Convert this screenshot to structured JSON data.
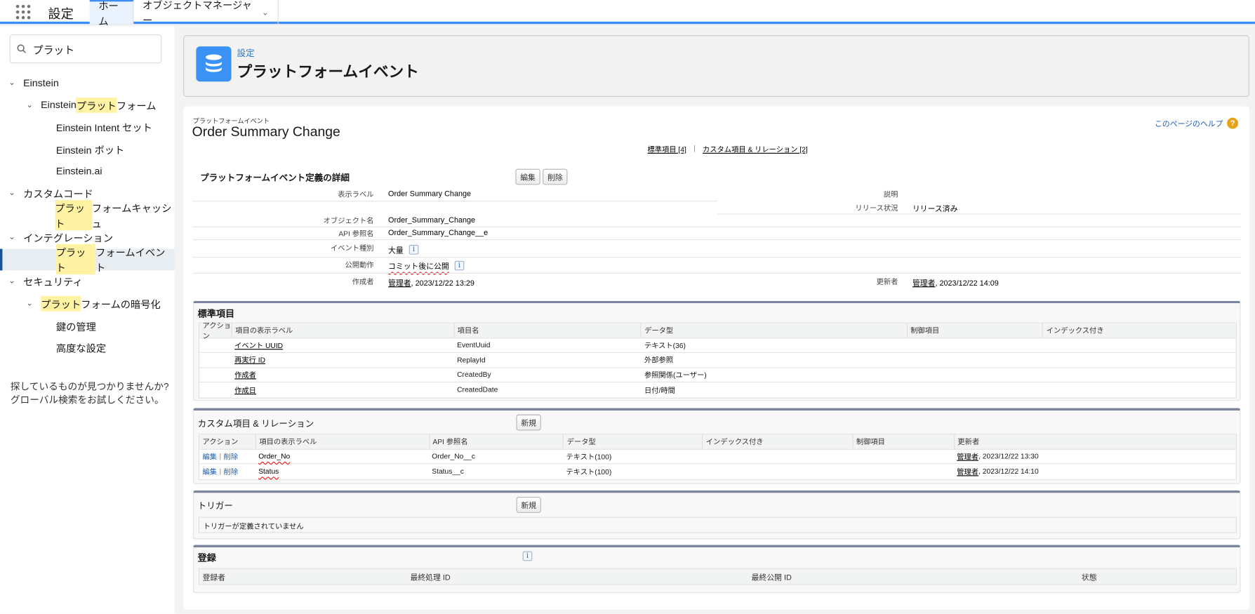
{
  "topbar": {
    "app_title": "設定",
    "tabs": [
      {
        "label": "ホーム"
      },
      {
        "label": "オブジェクトマネージャー"
      }
    ]
  },
  "sidebar": {
    "search_value": "プラット",
    "items": [
      {
        "pre": "Einstein",
        "hl": "",
        "post": ""
      },
      {
        "pre": "Einstein ",
        "hl": "プラット",
        "post": "フォーム"
      },
      {
        "pre": "Einstein Intent セット",
        "hl": "",
        "post": ""
      },
      {
        "pre": "Einstein ボット",
        "hl": "",
        "post": ""
      },
      {
        "pre": "Einstein.ai",
        "hl": "",
        "post": ""
      },
      {
        "pre": "カスタムコード",
        "hl": "",
        "post": ""
      },
      {
        "pre": "",
        "hl": "プラット",
        "post": "フォームキャッシュ"
      },
      {
        "pre": "インテグレーション",
        "hl": "",
        "post": ""
      },
      {
        "pre": "",
        "hl": "プラット",
        "post": "フォームイベント"
      },
      {
        "pre": "セキュリティ",
        "hl": "",
        "post": ""
      },
      {
        "pre": "",
        "hl": "プラット",
        "post": "フォームの暗号化"
      },
      {
        "pre": "鍵の管理",
        "hl": "",
        "post": ""
      },
      {
        "pre": "高度な設定",
        "hl": "",
        "post": ""
      }
    ],
    "not_found_line1": "探しているものが見つかりませんか?",
    "not_found_line2": "グローバル検索をお試しください。"
  },
  "header": {
    "breadcrumb": "設定",
    "title": "プラットフォームイベント"
  },
  "detail": {
    "type_label": "プラットフォームイベント",
    "title": "Order Summary Change",
    "help_link": "このページのヘルプ",
    "link_standard": "標準項目 [4]",
    "link_custom": "カスタム項目 & リレーション [2]",
    "link_sep": "|",
    "section_title": "プラットフォームイベント定義の詳細",
    "edit_button": "編集",
    "delete_button": "削除",
    "fields": {
      "label_l": "表示ラベル",
      "label_v": "Order Summary Change",
      "desc_l": "説明",
      "desc_v": "",
      "status_l": "リリース状況",
      "status_v": "リリース済み",
      "obj_l": "オブジェクト名",
      "obj_v": "Order_Summary_Change",
      "api_l": "API 参照名",
      "api_v": "Order_Summary_Change__e",
      "evtype_l": "イベント種別",
      "evtype_v": "大量",
      "publish_l": "公開動作",
      "publish_v": "コミット後に公開",
      "created_l": "作成者",
      "created_user": "管理者",
      "created_date": ", 2023/12/22 13:29",
      "modified_l": "更新者",
      "modified_user": "管理者",
      "modified_date": ", 2023/12/22 14:09"
    }
  },
  "standard": {
    "title": "標準項目",
    "columns": [
      "アクション",
      "項目の表示ラベル",
      "項目名",
      "データ型",
      "制御項目",
      "インデックス付き"
    ],
    "rows": [
      {
        "label": "イベント UUID",
        "name": "EventUuid",
        "type": "テキスト(36)"
      },
      {
        "label": "再実行 ID",
        "name": "ReplayId",
        "type": "外部参照"
      },
      {
        "label": "作成者",
        "name": "CreatedBy",
        "type": "参照関係(ユーザー)"
      },
      {
        "label": "作成日",
        "name": "CreatedDate",
        "type": "日付/時間"
      }
    ]
  },
  "custom": {
    "title": "カスタム項目 & リレーション",
    "new_button": "新規",
    "columns": [
      "アクション",
      "項目の表示ラベル",
      "API 参照名",
      "データ型",
      "インデックス付き",
      "制御項目",
      "更新者"
    ],
    "edit": "編集",
    "sep": "|",
    "delete": "削除",
    "rows": [
      {
        "label": "Order_No",
        "api": "Order_No__c",
        "type": "テキスト(100)",
        "user": "管理者",
        "date": ", 2023/12/22 13:30"
      },
      {
        "label": "Status",
        "api": "Status__c",
        "type": "テキスト(100)",
        "user": "管理者",
        "date": ", 2023/12/22 14:10"
      }
    ]
  },
  "triggers": {
    "title": "トリガー",
    "new_button": "新規",
    "empty": "トリガーが定義されていません"
  },
  "subscriptions": {
    "title": "登録",
    "columns": [
      "登録者",
      "最終処理 ID",
      "最終公開 ID",
      "状態"
    ]
  },
  "colors": {
    "accent": "#3e8ef7",
    "section_border": "#7a859c",
    "highlight": "#fff3a3"
  }
}
